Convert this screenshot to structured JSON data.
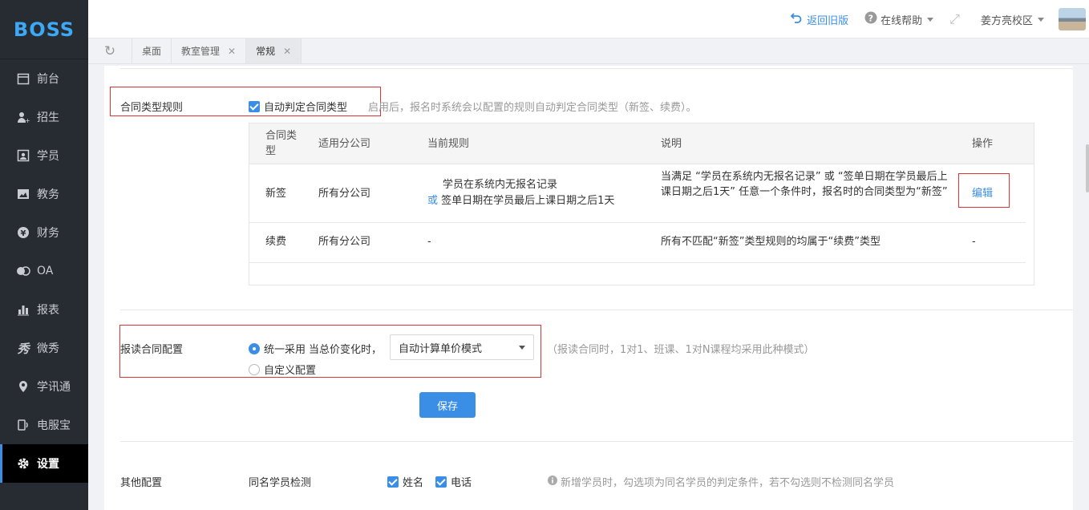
{
  "app": {
    "logo": "BOSS"
  },
  "sidebar": {
    "items": [
      {
        "label": "前台",
        "icon": "calendar-icon"
      },
      {
        "label": "招生",
        "icon": "user-add-icon"
      },
      {
        "label": "学员",
        "icon": "student-card-icon"
      },
      {
        "label": "教务",
        "icon": "image-board-icon"
      },
      {
        "label": "财务",
        "icon": "yen-icon"
      },
      {
        "label": "OA",
        "icon": "oa-icon"
      },
      {
        "label": "报表",
        "icon": "bar-chart-icon"
      },
      {
        "label": "微秀",
        "icon": "weixiu-icon"
      },
      {
        "label": "学讯通",
        "icon": "location-pin-icon"
      },
      {
        "label": "电服宝",
        "icon": "phone-icon"
      },
      {
        "label": "设置",
        "icon": "gear-icon",
        "active": true
      }
    ]
  },
  "header": {
    "back_old": "返回旧版",
    "help": "在线帮助",
    "campus": "姜方亮校区"
  },
  "tabs": [
    {
      "label": "桌面",
      "closable": false
    },
    {
      "label": "教室管理",
      "closable": true
    },
    {
      "label": "常规",
      "closable": true,
      "active": true
    }
  ],
  "contract_type": {
    "section_label": "合同类型规则",
    "checkbox_label": "自动判定合同类型",
    "checked": true,
    "hint": "启用后，报名时系统会以配置的规则自动判定合同类型（新签、续费）。",
    "columns": [
      "合同类型",
      "适用分公司",
      "当前规则",
      "说明",
      "操作"
    ],
    "rows": [
      {
        "type": "新签",
        "branch": "所有分公司",
        "rule_line1": "学员在系统内无报名记录",
        "rule_or": "或",
        "rule_line2": "签单日期在学员最后上课日期之后1天",
        "desc": "当满足 “学员在系统内无报名记录” 或 “签单日期在学员最后上课日期之后1天” 任意一个条件时，报名时的合同类型为“新签”",
        "action": "编辑"
      },
      {
        "type": "续费",
        "branch": "所有分公司",
        "rule": "-",
        "desc": "所有不匹配“新签”类型规则的均属于“续费”类型",
        "action": "-"
      }
    ]
  },
  "contract_config": {
    "section_label": "报读合同配置",
    "option_unified": "统一采用",
    "option_unified_suffix": "当总价变化时，",
    "select_value": "自动计算单价模式",
    "option_custom": "自定义配置",
    "selected": "unified",
    "hint": "（报读合同时，1对1、班课、1对N课程均采用此种模式）"
  },
  "save_label": "保存",
  "other_config": {
    "section_label": "其他配置",
    "field_label": "同名学员检测",
    "option_name": "姓名",
    "option_phone": "电话",
    "hint": "新增学员时，勾选项为同名学员的判定条件，若不勾选则不检测同名学员"
  }
}
